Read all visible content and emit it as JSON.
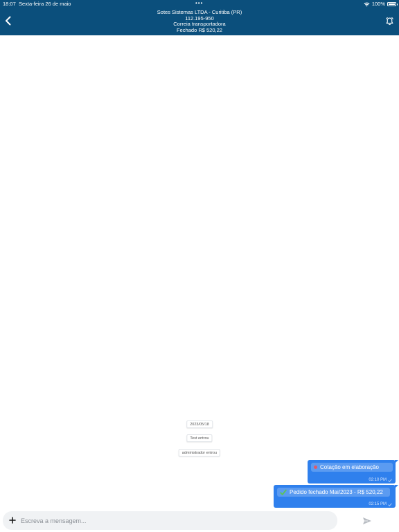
{
  "status_bar": {
    "time": "18:07",
    "date": "Sexta-feira 26 de maio",
    "dots": "•••",
    "battery": "100%"
  },
  "header": {
    "company": "Sotes Sistemas LTDA - Curitiba (PR)",
    "code": "112.195-950",
    "carrier": "Correia transportadora",
    "status": "Fechado R$ 520,22"
  },
  "system_messages": [
    "2023/05/18",
    "Test entrou",
    "administrador entrou"
  ],
  "messages": [
    {
      "text": "Cotação em elaboração",
      "time": "02:10 PM",
      "icon": "red-dot-icon"
    },
    {
      "text": "Pedido fechado Mai/2023 - R$ 520,22",
      "time": "02:15 PM",
      "icon": "check-icon"
    }
  ],
  "composer": {
    "placeholder": "Escreva a mensagem..."
  },
  "colors": {
    "header_bg": "#0b4f7c",
    "bubble_bg": "#2f80ed",
    "chip_bg": "#5b9bf1"
  }
}
